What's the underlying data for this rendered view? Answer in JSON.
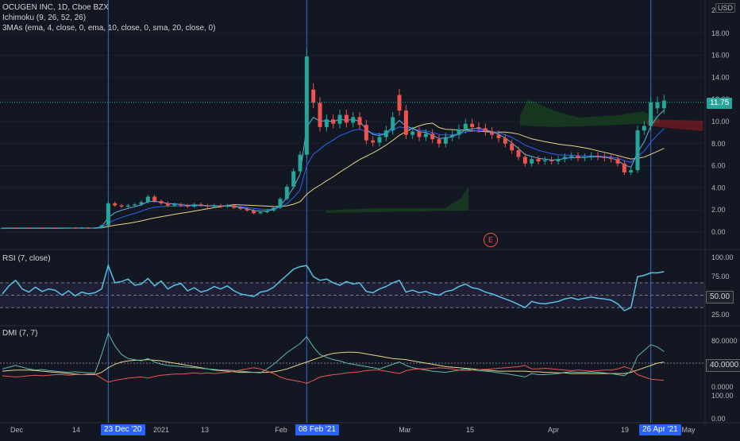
{
  "header": {
    "symbol_line": "OCUGEN INC, 1D, Cboe BZX",
    "ichimoku_line": "Ichimoku (9, 26, 52, 26)",
    "mas_line": "3MAs (ema, 4, close, 0, ema, 10, close, 0, sma, 20, close, 0)",
    "currency_label": "USD"
  },
  "price_axis": {
    "ticks": [
      "2",
      "18.00",
      "16.00",
      "14.00",
      "12.00",
      "10.00",
      "8.00",
      "6.00",
      "4.00",
      "2.00",
      "0.00"
    ],
    "last_price": "11.75"
  },
  "rsi_pane": {
    "label": "RSI (7, close)",
    "ticks": [
      "100.00",
      "75.00",
      "25.00"
    ],
    "current_value": "50.00"
  },
  "dmi_pane": {
    "label": "DMI (7, 7)",
    "ticks": [
      "80.0000",
      "0.0000",
      "100.00",
      "0.00"
    ],
    "current_value": "40.0000"
  },
  "time_axis": {
    "labels": [
      "Dec",
      "14",
      "2021",
      "13",
      "Feb",
      "Mar",
      "15",
      "Apr",
      "19",
      "May"
    ],
    "highlights": [
      "23 Dec '20",
      "08 Feb '21",
      "26 Apr '21"
    ]
  },
  "earnings_marker": "E",
  "colors": {
    "background": "#131722",
    "up": "#26a69a",
    "down": "#ef5350",
    "ema4": "#5eb5e0",
    "ema10": "#2962ff",
    "sma20": "#e8d38b",
    "rsi": "#56c3e6",
    "plus_di": "#62b8a8",
    "minus_di": "#ef5350",
    "adx": "#e8d38b",
    "cursor": "#2f6fd6",
    "badge": "#2962ff"
  },
  "chart_data": {
    "type": "candlestick",
    "title": "OCUGEN INC, 1D, Cboe BZX",
    "dates": [
      "2020-12-01",
      "2020-12-02",
      "2020-12-03",
      "2020-12-04",
      "2020-12-07",
      "2020-12-08",
      "2020-12-09",
      "2020-12-10",
      "2020-12-11",
      "2020-12-14",
      "2020-12-15",
      "2020-12-16",
      "2020-12-17",
      "2020-12-18",
      "2020-12-21",
      "2020-12-22",
      "2020-12-23",
      "2020-12-24",
      "2020-12-28",
      "2020-12-29",
      "2020-12-30",
      "2020-12-31",
      "2021-01-04",
      "2021-01-05",
      "2021-01-06",
      "2021-01-07",
      "2021-01-08",
      "2021-01-11",
      "2021-01-12",
      "2021-01-13",
      "2021-01-14",
      "2021-01-15",
      "2021-01-19",
      "2021-01-20",
      "2021-01-21",
      "2021-01-22",
      "2021-01-25",
      "2021-01-26",
      "2021-01-27",
      "2021-01-28",
      "2021-01-29",
      "2021-02-01",
      "2021-02-02",
      "2021-02-03",
      "2021-02-04",
      "2021-02-05",
      "2021-02-08",
      "2021-02-09",
      "2021-02-10",
      "2021-02-11",
      "2021-02-12",
      "2021-02-16",
      "2021-02-17",
      "2021-02-18",
      "2021-02-19",
      "2021-02-22",
      "2021-02-23",
      "2021-02-24",
      "2021-02-25",
      "2021-02-26",
      "2021-03-01",
      "2021-03-02",
      "2021-03-03",
      "2021-03-04",
      "2021-03-05",
      "2021-03-08",
      "2021-03-09",
      "2021-03-10",
      "2021-03-11",
      "2021-03-12",
      "2021-03-15",
      "2021-03-16",
      "2021-03-17",
      "2021-03-18",
      "2021-03-19",
      "2021-03-22",
      "2021-03-23",
      "2021-03-24",
      "2021-03-25",
      "2021-03-26",
      "2021-03-29",
      "2021-03-30",
      "2021-03-31",
      "2021-04-01",
      "2021-04-05",
      "2021-04-06",
      "2021-04-07",
      "2021-04-08",
      "2021-04-09",
      "2021-04-12",
      "2021-04-13",
      "2021-04-14",
      "2021-04-15",
      "2021-04-16",
      "2021-04-19",
      "2021-04-20",
      "2021-04-21",
      "2021-04-22",
      "2021-04-23",
      "2021-04-26",
      "2021-04-27"
    ],
    "close": [
      0.35,
      0.36,
      0.35,
      0.36,
      0.35,
      0.36,
      0.35,
      0.36,
      0.35,
      0.36,
      0.37,
      0.36,
      0.37,
      0.36,
      0.37,
      0.6,
      2.6,
      2.4,
      2.3,
      2.4,
      2.5,
      2.7,
      3.2,
      2.8,
      2.6,
      2.4,
      2.5,
      2.4,
      2.3,
      2.5,
      2.4,
      2.3,
      2.4,
      2.3,
      2.4,
      2.2,
      2.1,
      1.95,
      1.7,
      1.8,
      1.95,
      2.2,
      3.0,
      4.1,
      5.5,
      7.0,
      15.9,
      11.7,
      9.5,
      10.2,
      9.8,
      10.6,
      9.9,
      10.4,
      9.7,
      8.3,
      8.1,
      8.6,
      9.2,
      10.4,
      11.0,
      8.8,
      9.1,
      8.6,
      8.9,
      8.4,
      8.0,
      8.6,
      8.8,
      9.3,
      9.8,
      9.5,
      9.4,
      9.1,
      8.8,
      8.5,
      8.0,
      7.4,
      6.8,
      6.2,
      6.6,
      6.4,
      6.5,
      6.4,
      6.6,
      6.8,
      6.9,
      6.7,
      6.8,
      6.9,
      6.8,
      6.7,
      6.6,
      6.2,
      5.4,
      5.6,
      9.2,
      9.6,
      11.75,
      11.75,
      11.9
    ],
    "open": [
      0.35,
      0.35,
      0.36,
      0.35,
      0.36,
      0.35,
      0.36,
      0.35,
      0.36,
      0.35,
      0.36,
      0.37,
      0.36,
      0.37,
      0.36,
      0.37,
      0.6,
      2.6,
      2.4,
      2.3,
      2.4,
      2.5,
      2.7,
      3.2,
      2.8,
      2.6,
      2.4,
      2.5,
      2.4,
      2.3,
      2.5,
      2.4,
      2.3,
      2.4,
      2.3,
      2.4,
      2.2,
      2.1,
      1.95,
      1.7,
      1.8,
      1.95,
      2.2,
      3.0,
      4.1,
      5.5,
      7.0,
      12.9,
      11.7,
      9.5,
      10.2,
      9.8,
      10.6,
      9.9,
      10.4,
      9.7,
      8.3,
      8.1,
      8.6,
      9.2,
      12.4,
      11.0,
      8.8,
      9.1,
      8.6,
      8.9,
      8.4,
      8.0,
      8.6,
      8.8,
      9.3,
      9.8,
      9.5,
      9.4,
      9.1,
      8.8,
      8.5,
      8.0,
      7.4,
      6.8,
      6.2,
      6.6,
      6.4,
      6.5,
      6.4,
      6.6,
      6.8,
      6.9,
      6.7,
      6.8,
      6.9,
      6.8,
      6.7,
      6.6,
      6.2,
      5.4,
      5.6,
      9.2,
      9.6,
      11.2,
      11.2
    ],
    "ylim": [
      -0.8,
      20.5
    ],
    "ichimoku_params": [
      9,
      26,
      52,
      26
    ],
    "ma_params": {
      "ema_fast": 4,
      "ema_slow": 10,
      "sma": 20
    },
    "rsi": [
      52,
      65,
      74,
      60,
      55,
      63,
      56,
      60,
      58,
      50,
      57,
      49,
      55,
      52,
      54,
      60,
      98,
      70,
      72,
      76,
      66,
      68,
      77,
      65,
      73,
      60,
      66,
      69,
      57,
      62,
      55,
      58,
      64,
      60,
      65,
      57,
      52,
      50,
      48,
      55,
      57,
      63,
      73,
      82,
      92,
      96,
      98,
      80,
      74,
      76,
      70,
      66,
      72,
      68,
      70,
      56,
      54,
      60,
      64,
      70,
      74,
      55,
      58,
      54,
      56,
      52,
      50,
      56,
      58,
      64,
      68,
      62,
      60,
      55,
      52,
      48,
      44,
      40,
      35,
      30,
      40,
      37,
      36,
      38,
      40,
      44,
      46,
      43,
      45,
      47,
      45,
      44,
      42,
      36,
      25,
      30,
      80,
      82,
      86,
      86,
      88
    ],
    "rsi_ylim": [
      0,
      100
    ],
    "dmi_plus": [
      30,
      33,
      36,
      33,
      30,
      28,
      29,
      27,
      26,
      25,
      24,
      25,
      24,
      23,
      23,
      55,
      92,
      70,
      55,
      48,
      46,
      44,
      48,
      42,
      38,
      36,
      35,
      34,
      33,
      32,
      31,
      30,
      29,
      28,
      28,
      27,
      26,
      25,
      24,
      23,
      30,
      38,
      48,
      58,
      66,
      74,
      86,
      68,
      55,
      50,
      46,
      44,
      40,
      38,
      36,
      34,
      32,
      30,
      34,
      38,
      42,
      36,
      32,
      30,
      28,
      26,
      25,
      24,
      26,
      28,
      30,
      28,
      27,
      26,
      25,
      23,
      22,
      20,
      18,
      16,
      22,
      20,
      20,
      21,
      22,
      24,
      25,
      24,
      24,
      25,
      24,
      23,
      22,
      20,
      18,
      26,
      52,
      62,
      72,
      68,
      60
    ],
    "dmi_minus": [
      18,
      17,
      16,
      17,
      18,
      19,
      18,
      19,
      20,
      20,
      19,
      20,
      20,
      21,
      21,
      14,
      7,
      10,
      12,
      14,
      15,
      16,
      14,
      17,
      19,
      20,
      21,
      21,
      22,
      23,
      22,
      23,
      22,
      23,
      24,
      26,
      28,
      30,
      32,
      30,
      26,
      22,
      16,
      12,
      10,
      8,
      5,
      10,
      16,
      18,
      20,
      21,
      23,
      24,
      25,
      27,
      28,
      28,
      26,
      24,
      22,
      27,
      29,
      30,
      30,
      31,
      32,
      31,
      30,
      28,
      27,
      28,
      29,
      29,
      30,
      31,
      32,
      33,
      34,
      36,
      30,
      30,
      31,
      30,
      29,
      28,
      27,
      28,
      27,
      26,
      27,
      28,
      28,
      30,
      34,
      30,
      20,
      16,
      12,
      11,
      10
    ],
    "dmi_adx": [
      26,
      27,
      28,
      28,
      28,
      27,
      26,
      25,
      24,
      23,
      22,
      21,
      20,
      20,
      20,
      24,
      32,
      38,
      42,
      44,
      45,
      45,
      46,
      45,
      44,
      42,
      40,
      38,
      36,
      34,
      32,
      30,
      28,
      27,
      26,
      25,
      24,
      24,
      24,
      24,
      24,
      25,
      27,
      30,
      34,
      38,
      42,
      46,
      50,
      54,
      57,
      58,
      59,
      59,
      58,
      56,
      54,
      52,
      50,
      48,
      47,
      46,
      44,
      42,
      40,
      38,
      36,
      34,
      33,
      32,
      31,
      30,
      29,
      28,
      27,
      26,
      26,
      26,
      26,
      26,
      25,
      25,
      24,
      24,
      23,
      23,
      22,
      22,
      22,
      22,
      22,
      22,
      22,
      22,
      22,
      24,
      28,
      32,
      36,
      40,
      42
    ],
    "dmi_ylim": [
      -15,
      100
    ]
  }
}
